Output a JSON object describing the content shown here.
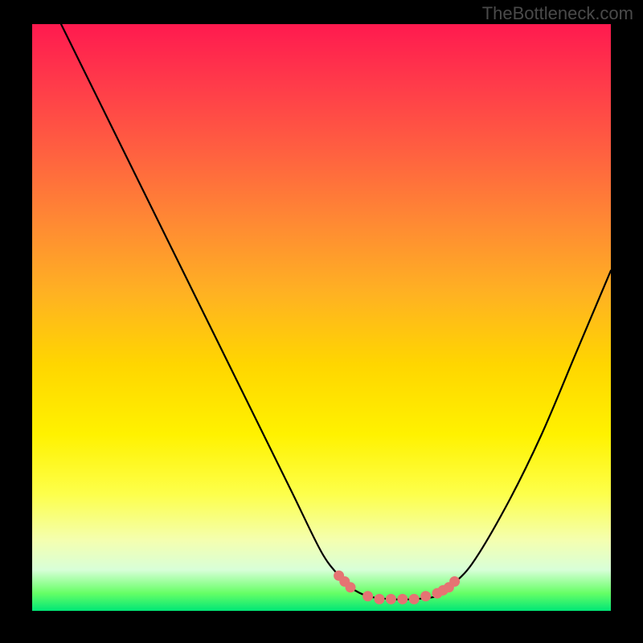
{
  "watermark": "TheBottleneck.com",
  "chart_data": {
    "type": "line",
    "title": "",
    "xlabel": "",
    "ylabel": "",
    "xlim": [
      0,
      100
    ],
    "ylim": [
      0,
      100
    ],
    "gradient_stops": [
      {
        "pos": 0,
        "color": "#ff1a4f"
      },
      {
        "pos": 10,
        "color": "#ff3a4a"
      },
      {
        "pos": 22,
        "color": "#ff6140"
      },
      {
        "pos": 34,
        "color": "#ff8a33"
      },
      {
        "pos": 46,
        "color": "#ffb222"
      },
      {
        "pos": 58,
        "color": "#ffd600"
      },
      {
        "pos": 70,
        "color": "#fff200"
      },
      {
        "pos": 80,
        "color": "#fdff4a"
      },
      {
        "pos": 88,
        "color": "#f4ffb0"
      },
      {
        "pos": 93,
        "color": "#d8ffd8"
      },
      {
        "pos": 97,
        "color": "#66ff66"
      },
      {
        "pos": 100,
        "color": "#00e676"
      }
    ],
    "series": [
      {
        "name": "bottleneck-curve",
        "color": "#000000",
        "x": [
          5,
          10,
          15,
          20,
          25,
          30,
          35,
          40,
          45,
          50,
          53,
          55,
          58,
          62,
          66,
          70,
          72,
          76,
          82,
          88,
          94,
          100
        ],
        "y": [
          100,
          90,
          80,
          70,
          60,
          50,
          40,
          30,
          20,
          10,
          6,
          4,
          2.5,
          2,
          2,
          2.5,
          4,
          8,
          18,
          30,
          44,
          58
        ]
      }
    ],
    "markers": {
      "name": "optimal-range-dots",
      "color": "#e57373",
      "x": [
        53,
        54,
        55,
        58,
        60,
        62,
        64,
        66,
        68,
        70,
        71,
        72,
        73
      ],
      "y": [
        6,
        5,
        4,
        2.5,
        2,
        2,
        2,
        2,
        2.5,
        3,
        3.5,
        4,
        5
      ]
    }
  }
}
